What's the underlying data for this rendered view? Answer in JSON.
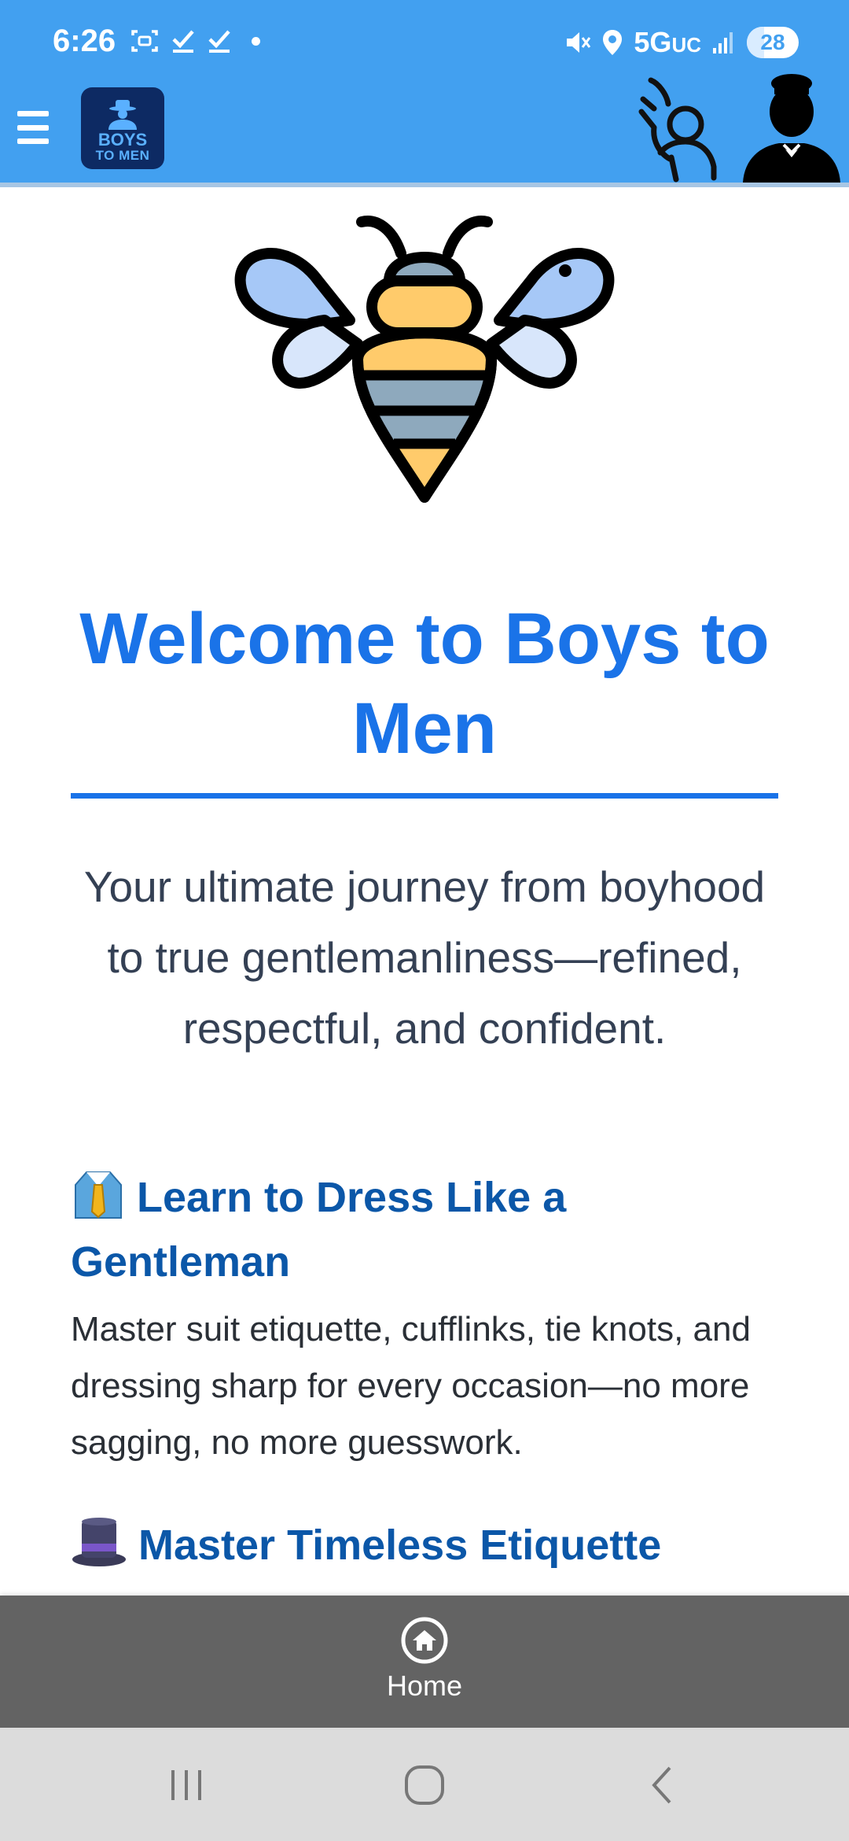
{
  "status_bar": {
    "time": "6:26",
    "network": "5G",
    "network_suffix": "UC",
    "battery": "28",
    "battery_level_percent": 28,
    "icons": [
      "screenshot-icon",
      "check-icon",
      "check-icon",
      "dot-icon",
      "mute-icon",
      "location-icon",
      "signal-icon",
      "battery-icon"
    ]
  },
  "header": {
    "logo_line1": "BOYS",
    "logo_line2": "TO MEN",
    "menu_icon": "hamburger-icon",
    "right_icons": [
      "raised-hand-person-icon",
      "gentleman-avatar-icon"
    ]
  },
  "colors": {
    "header_blue": "#42a0f0",
    "title_blue": "#1a73e8",
    "heading_blue": "#0b57a8",
    "nav_gray": "#636363"
  },
  "main": {
    "hero_icon": "bee-icon",
    "title": "Welcome to Boys to Men",
    "intro": "Your ultimate journey from boyhood to true gentlemanliness—refined, respectful, and confident.",
    "features": [
      {
        "emoji": "👔",
        "heading": "Learn to Dress Like a Gentleman",
        "text": "Master suit etiquette, cufflinks, tie knots, and dressing sharp for every occasion—no more sagging, no more guesswork."
      },
      {
        "emoji": "🎩",
        "heading": "Master Timeless Etiquette"
      }
    ]
  },
  "bottom_nav": {
    "items": [
      {
        "label": "Home",
        "icon": "home-icon"
      }
    ]
  },
  "system_nav": {
    "buttons": [
      "recent-apps-icon",
      "home-circle-icon",
      "back-icon"
    ]
  }
}
